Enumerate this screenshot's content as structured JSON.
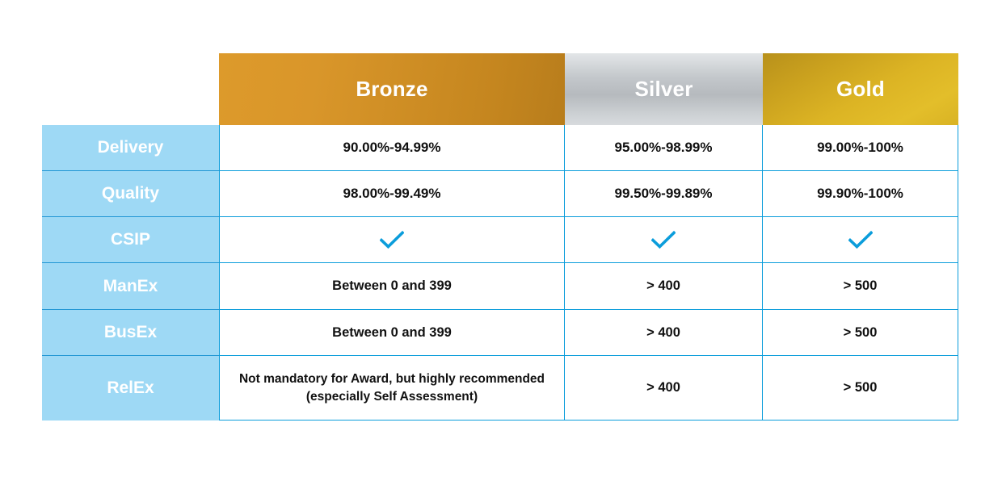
{
  "table": {
    "corner_label": "",
    "columns": [
      {
        "key": "bronze",
        "label": "Bronze",
        "color": "#cf8f25"
      },
      {
        "key": "silver",
        "label": "Silver",
        "color": "#c3c7cb"
      },
      {
        "key": "gold",
        "label": "Gold",
        "color": "#d4ac22"
      }
    ],
    "accent_blue": "#0b9ddb",
    "label_bg": "#9ed9f5",
    "rows": [
      {
        "label": "Delivery",
        "bronze": "90.00%-94.99%",
        "silver": "95.00%-98.99%",
        "gold": "99.00%-100%"
      },
      {
        "label": "Quality",
        "bronze": "98.00%-99.49%",
        "silver": "99.50%-99.89%",
        "gold": "99.90%-100%"
      },
      {
        "label": "CSIP",
        "bronze": "check-icon",
        "silver": "check-icon",
        "gold": "check-icon"
      },
      {
        "label": "ManEx",
        "bronze": "Between 0 and 399",
        "silver": "> 400",
        "gold": "> 500"
      },
      {
        "label": "BusEx",
        "bronze": "Between 0 and 399",
        "silver": "> 400",
        "gold": "> 500"
      },
      {
        "label": "RelEx",
        "bronze": "Not mandatory for Award, but highly recommended (especially Self Assessment)",
        "silver": "> 400",
        "gold": "> 500"
      }
    ]
  }
}
